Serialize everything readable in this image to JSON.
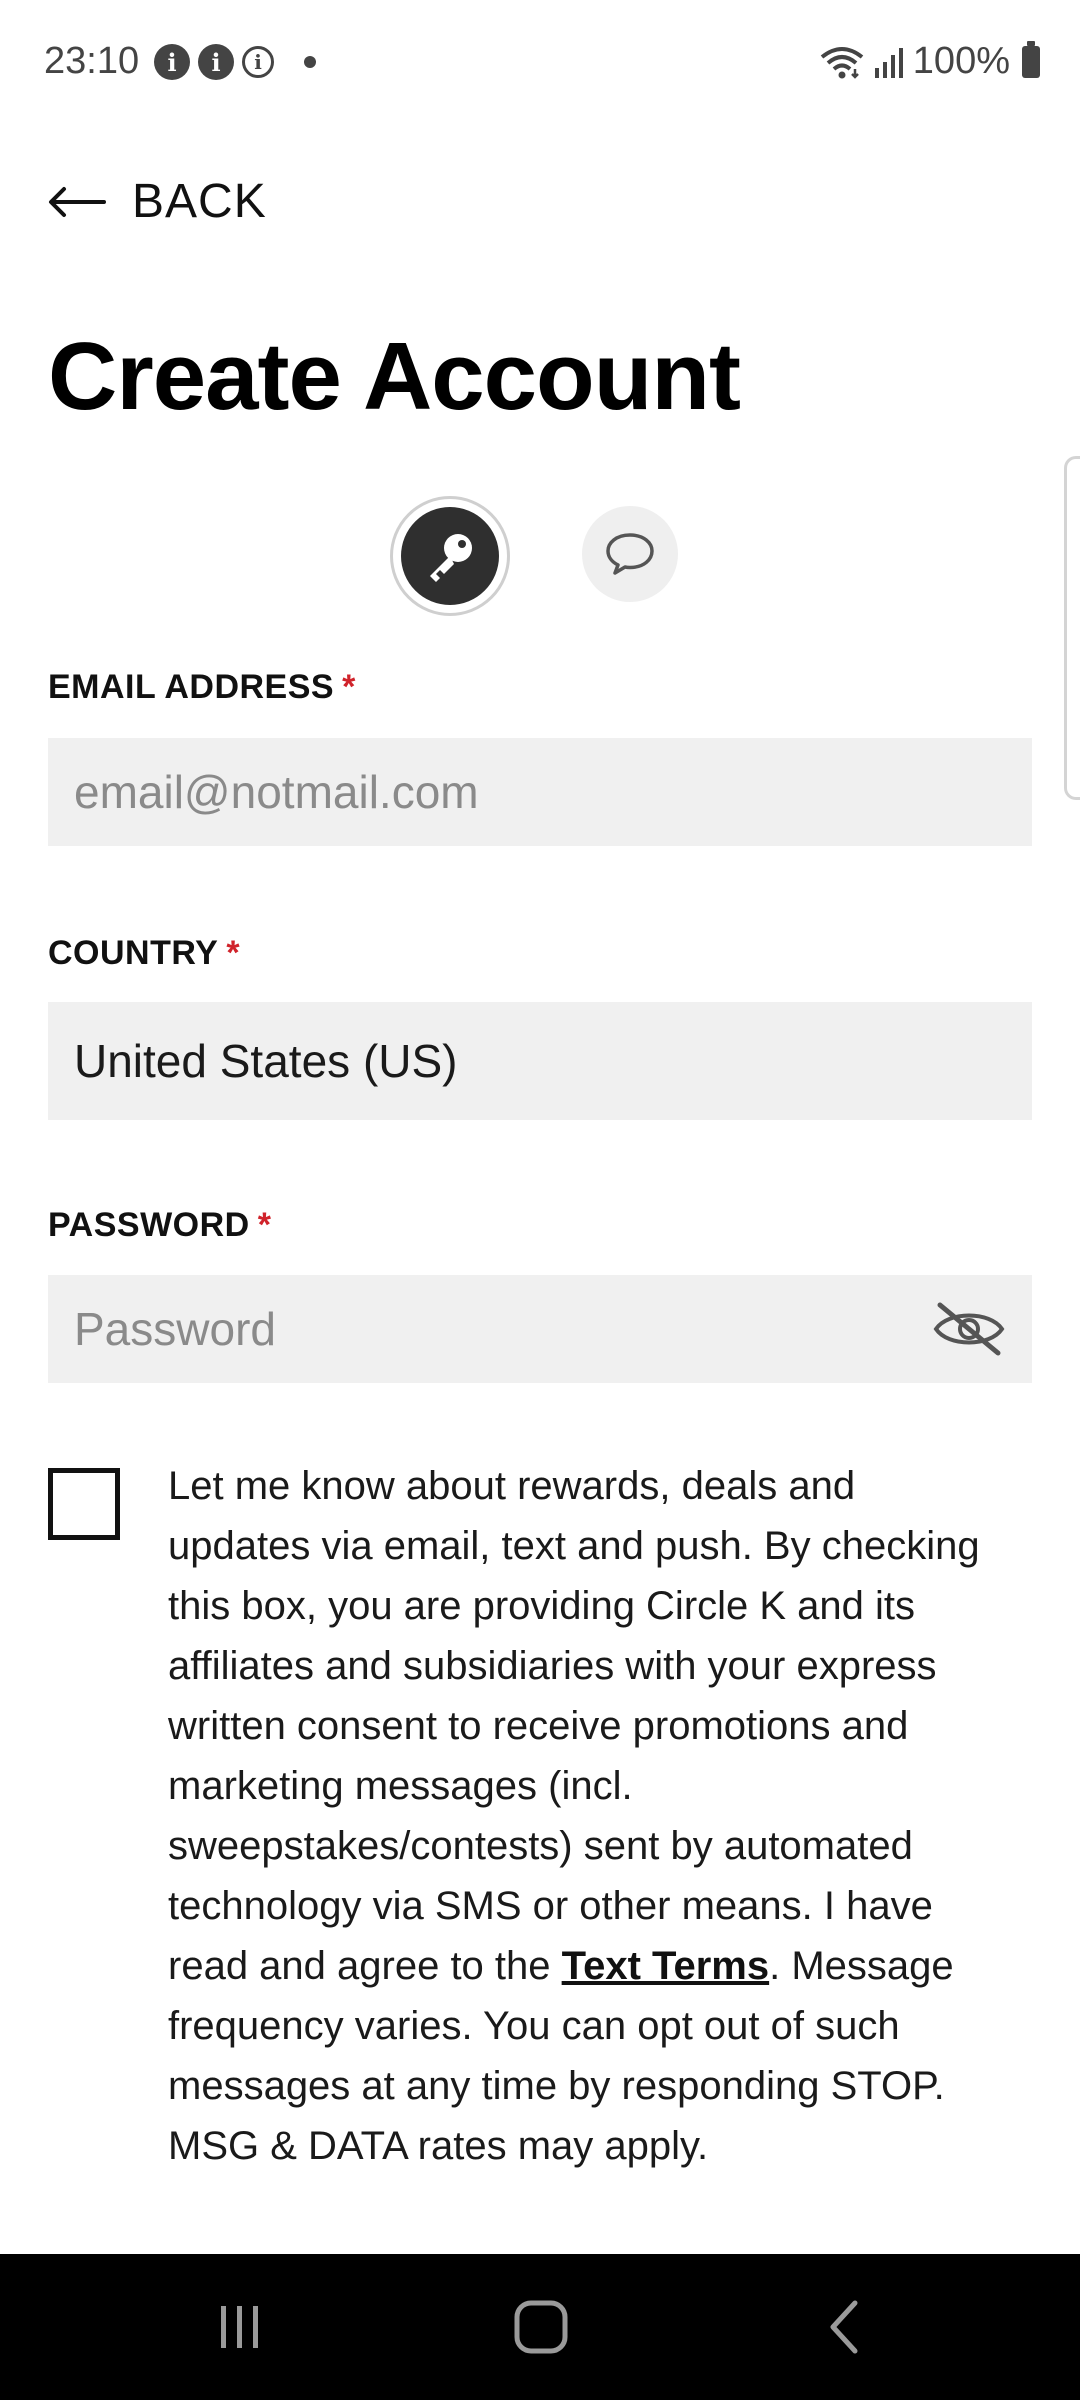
{
  "status_bar": {
    "time": "23:10",
    "battery": "100%",
    "info_icons": [
      "info-icon",
      "info-icon",
      "info-outline-icon"
    ],
    "right_icons": [
      "wifi-icon",
      "signal-icon",
      "battery-icon"
    ]
  },
  "header": {
    "back_label": "BACK",
    "title": "Create Account"
  },
  "auth_methods": [
    {
      "icon": "key-icon",
      "selected": true
    },
    {
      "icon": "chat-bubble-icon",
      "selected": false
    }
  ],
  "form": {
    "email": {
      "label": "EMAIL ADDRESS",
      "required_mark": "*",
      "placeholder": "email@notmail.com",
      "value": ""
    },
    "country": {
      "label": "COUNTRY",
      "required_mark": "*",
      "value": "United States (US)"
    },
    "password": {
      "label": "PASSWORD",
      "required_mark": "*",
      "placeholder": "Password",
      "value": "",
      "toggle_icon": "eye-off-icon"
    }
  },
  "consent": {
    "checked": false,
    "text_before": "Let me know about rewards, deals and updates via email, text and push. By checking this box, you are providing Circle K and its affiliates and subsidiaries with your express written consent to receive promotions and marketing messages (incl. sweepstakes/contests) sent by automated technology via SMS or other means. I have read and agree to the ",
    "link_text": "Text Terms",
    "text_after": ". Message frequency varies. You can opt out of such messages at any time by responding STOP. MSG & DATA rates may apply."
  },
  "nav_bar": {
    "buttons": [
      "recent-apps-icon",
      "home-icon",
      "back-nav-icon"
    ]
  },
  "colors": {
    "required": "#d0232b",
    "field_bg": "#f0f0f0",
    "nav_bg": "#000000"
  }
}
